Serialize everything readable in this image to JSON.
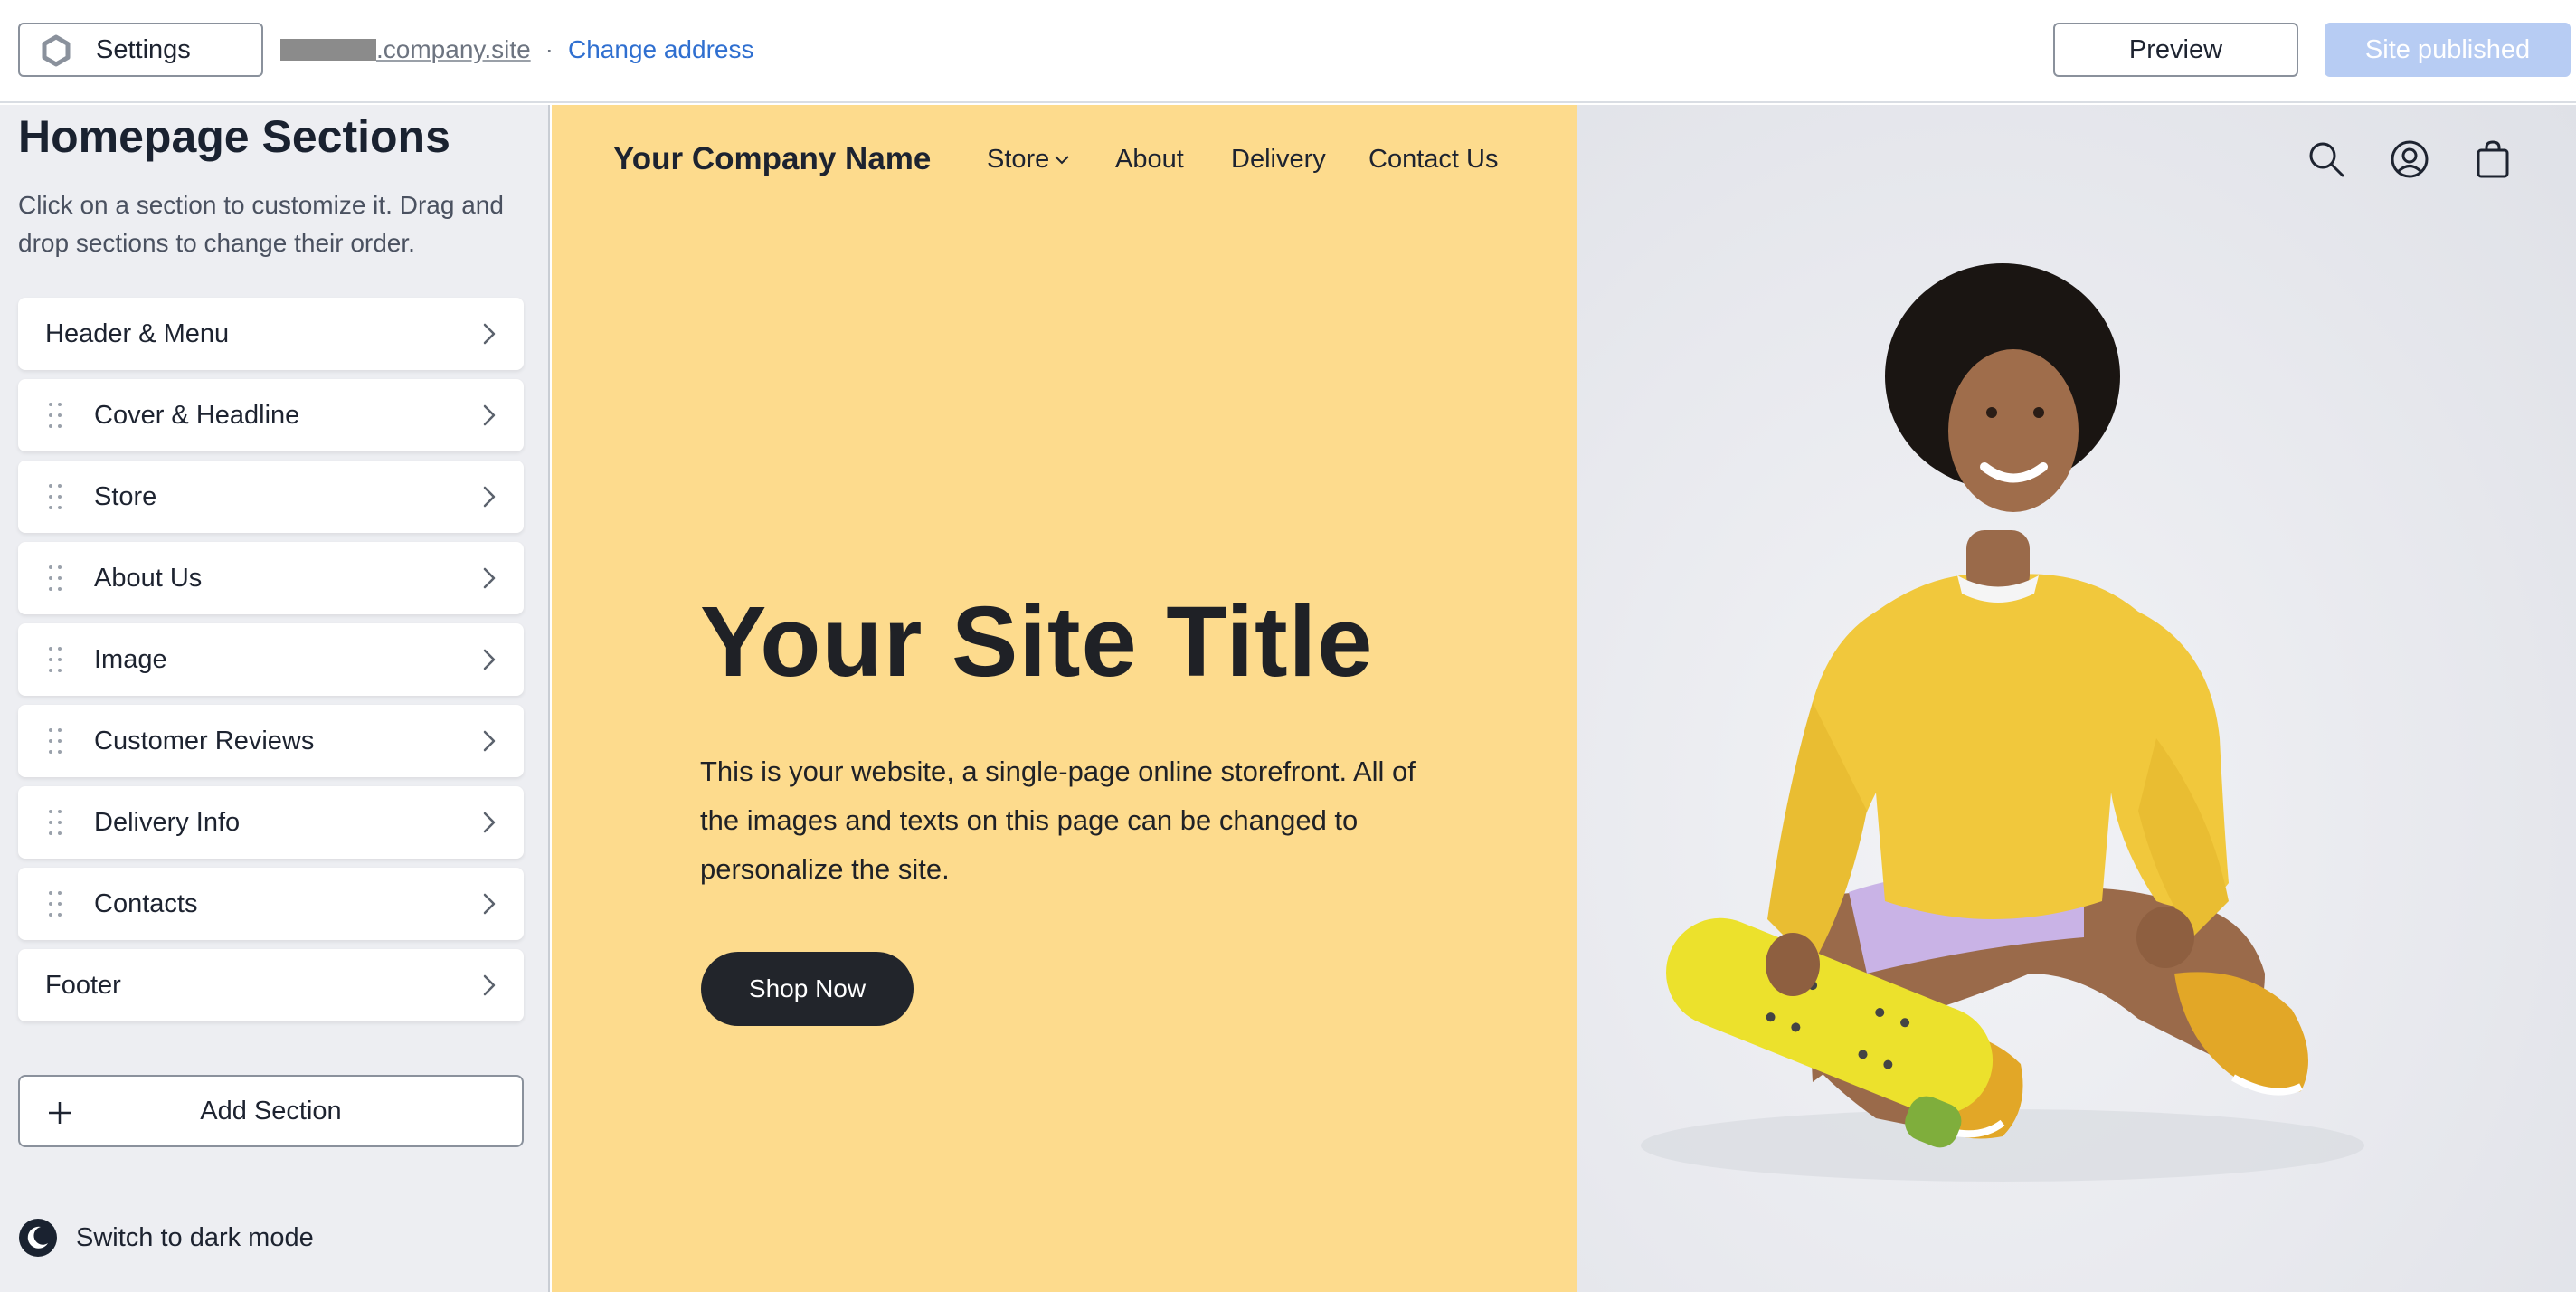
{
  "topbar": {
    "settings_label": "Settings",
    "address_domain": ".company.site",
    "address_separator": "·",
    "change_address_label": "Change address",
    "preview_label": "Preview",
    "published_label": "Site published"
  },
  "sidebar": {
    "title": "Homepage Sections",
    "description": "Click on a section to customize it. Drag and drop sections to change their order.",
    "sections": [
      {
        "label": "Header & Menu",
        "draggable": false
      },
      {
        "label": "Cover & Headline",
        "draggable": true
      },
      {
        "label": "Store",
        "draggable": true
      },
      {
        "label": "About Us",
        "draggable": true
      },
      {
        "label": "Image",
        "draggable": true
      },
      {
        "label": "Customer Reviews",
        "draggable": true
      },
      {
        "label": "Delivery Info",
        "draggable": true
      },
      {
        "label": "Contacts",
        "draggable": true
      },
      {
        "label": "Footer",
        "draggable": false
      }
    ],
    "add_section_label": "Add Section",
    "dark_mode_label": "Switch to dark mode"
  },
  "site": {
    "company_name": "Your Company Name",
    "nav": {
      "store": "Store",
      "about": "About",
      "delivery": "Delivery",
      "contact": "Contact Us"
    },
    "header_icons": [
      "search-icon",
      "account-icon",
      "cart-bag-icon"
    ],
    "title": "Your Site Title",
    "description": "This is your website, a single-page online storefront. All of the images and texts on this page can be changed to personalize the site.",
    "cta_label": "Shop Now"
  },
  "colors": {
    "accent_link": "#2f6fd0",
    "published_button": "#b7ccf3",
    "cover_background": "#fddb8d",
    "cta_background": "#22252b",
    "sidebar_background": "#edeef2"
  }
}
